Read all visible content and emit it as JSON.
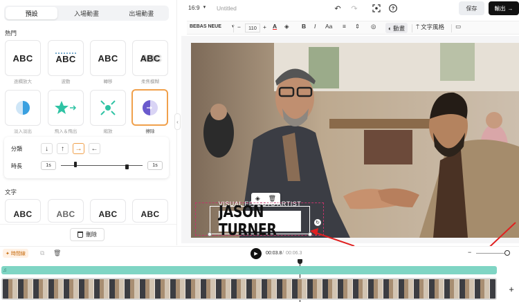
{
  "left_panel": {
    "tabs": [
      "預設",
      "入場動畫",
      "出場動畫"
    ],
    "active_tab": 0,
    "section_hot": "熱門",
    "hot_items": [
      {
        "label": "逐欄放大",
        "icon": "text-abc-icon"
      },
      {
        "label": "波動",
        "icon": "text-abc-wave-icon"
      },
      {
        "label": "轉移",
        "icon": "text-abc-shift-icon"
      },
      {
        "label": "柔焦模糊",
        "icon": "text-abc-blur-icon"
      },
      {
        "label": "淡入淡出",
        "icon": "fade-icon"
      },
      {
        "label": "飛入＆飛出",
        "icon": "fly-star-icon"
      },
      {
        "label": "縮放",
        "icon": "zoom-icon"
      },
      {
        "label": "擦除",
        "icon": "wipe-icon"
      }
    ],
    "options": {
      "direction_label": "分類",
      "duration_label": "時長",
      "in_value": "1s",
      "out_value": "1s",
      "directions": [
        "↓",
        "↑",
        "→",
        "←"
      ],
      "selected_direction": 2
    },
    "section_text": "文字",
    "text_items": [
      "ABC",
      "ABC",
      "ABC",
      "ABC"
    ],
    "delete_label": "刪除"
  },
  "top_bar": {
    "aspect": "16:9",
    "title": "Untitled",
    "save_label": "保存",
    "export_label": "輸出"
  },
  "toolbar": {
    "font": "BEBAS NEUE",
    "font_size": "110",
    "animation_label": "動畫",
    "text_style_label": "文字風格"
  },
  "canvas": {
    "caption_top": "VISUAL EFFECTS ARTIST",
    "caption_main": "JASON TURNER"
  },
  "timeline": {
    "tag_label": "時間線",
    "current_time": "00:03.8",
    "total_time": "00:06.3",
    "colors": {
      "audio_track": "#7fd5c4",
      "accent": "#f0a04b",
      "arrow": "#e02020"
    }
  }
}
